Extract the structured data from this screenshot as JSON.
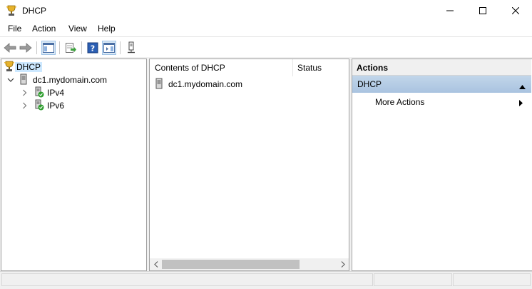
{
  "window": {
    "title": "DHCP",
    "controls": [
      "minimize",
      "maximize",
      "close"
    ]
  },
  "menu": {
    "file": "File",
    "action": "Action",
    "view": "View",
    "help": "Help"
  },
  "toolbar": {
    "buttons": [
      "back-arrow-icon",
      "forward-arrow-icon",
      "show-hide-console-tree-icon",
      "export-list-icon",
      "help-icon",
      "show-hide-action-pane-icon",
      "server-status-icon"
    ]
  },
  "tree": {
    "root": "DHCP",
    "server": "dc1.mydomain.com",
    "children": [
      "IPv4",
      "IPv6"
    ]
  },
  "list": {
    "columns": [
      "Contents of DHCP",
      "Status"
    ],
    "rows": [
      {
        "name": "dc1.mydomain.com",
        "status": ""
      }
    ]
  },
  "actions": {
    "header": "Actions",
    "section": "DHCP",
    "items": [
      "More Actions"
    ]
  },
  "colors": {
    "selection": "#cce8ff",
    "actions_section": "#b3cbe4"
  }
}
